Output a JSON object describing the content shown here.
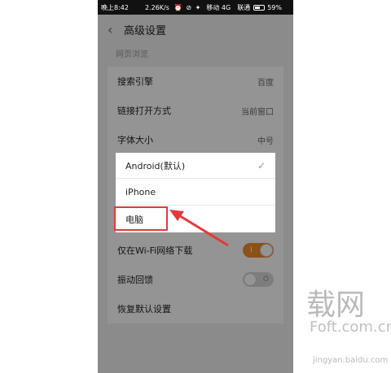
{
  "status_bar": {
    "time": "晚上8:42",
    "speed": "2.26K/s",
    "icons": "⏰ ⊘ ✦",
    "carrier1": "移动 4G",
    "carrier2": "联通",
    "battery": "59%"
  },
  "header": {
    "back_icon": "‹",
    "title": "高级设置"
  },
  "section": {
    "label": "网页浏览"
  },
  "rows": [
    {
      "label": "搜索引擎",
      "value": "百度"
    },
    {
      "label": "链接打开方式",
      "value": "当前窗口"
    },
    {
      "label": "字体大小",
      "value": "中号"
    },
    {
      "label": "仅在Wi-Fi网络下载",
      "toggle": "on",
      "mark": "I"
    },
    {
      "label": "振动回馈",
      "toggle": "off",
      "mark": "O"
    },
    {
      "label": "恢复默认设置"
    }
  ],
  "dialog": {
    "options": [
      {
        "label": "Android(默认)",
        "selected": true
      },
      {
        "label": "iPhone"
      },
      {
        "label": "电脑"
      }
    ],
    "check_icon": "✓"
  },
  "watermark": {
    "cn": "载网",
    "url": "Foft.com.cn",
    "jingyan": "jingyan.baidu.com"
  },
  "colors": {
    "accent_toggle": "#f28c28",
    "annotation_red": "#e23a3a"
  }
}
